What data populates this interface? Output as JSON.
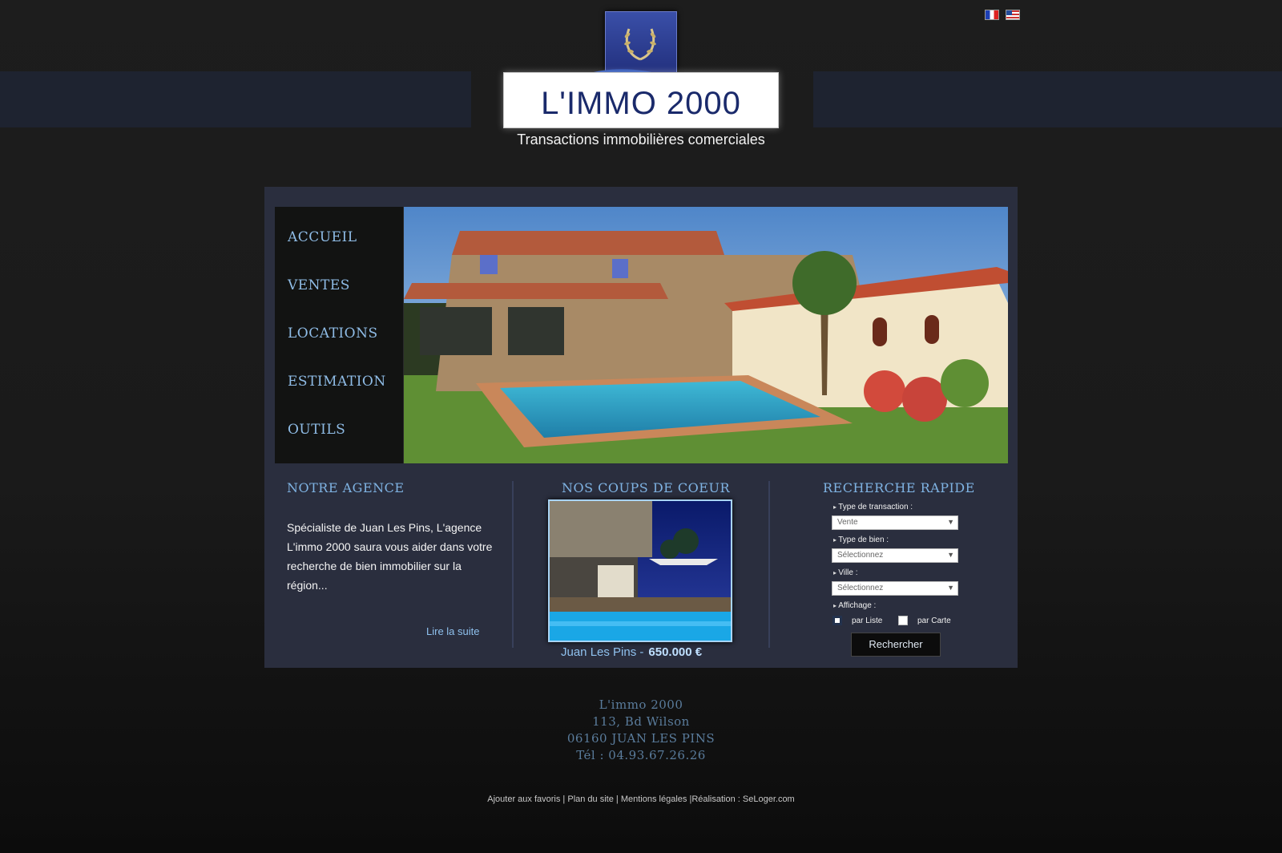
{
  "header": {
    "logo_text": "L'IMMO 2000",
    "tagline": "Transactions immobilières comerciales",
    "languages": [
      {
        "code": "fr",
        "icon": "french-flag-icon"
      },
      {
        "code": "en",
        "icon": "us-flag-icon"
      }
    ]
  },
  "nav": {
    "items": [
      "ACCUEIL",
      "VENTES",
      "LOCATIONS",
      "ESTIMATION",
      "OUTILS"
    ]
  },
  "agence": {
    "title": "NOTRE AGENCE",
    "text": "Spécialiste de Juan Les Pins, L'agence L'immo 2000 saura vous aider dans votre recherche de bien immobilier sur la région...",
    "read_more": "Lire la suite"
  },
  "coups_de_coeur": {
    "title": "NOS COUPS DE COEUR",
    "city": "Juan Les Pins -",
    "price": "650.000 €"
  },
  "recherche": {
    "title": "RECHERCHE RAPIDE",
    "transaction_label": "Type de transaction :",
    "transaction_value": "Vente",
    "bien_label": "Type de bien :",
    "bien_value": "Sélectionnez",
    "ville_label": "Ville :",
    "ville_value": "Sélectionnez",
    "affichage_label": "Affichage :",
    "par_liste": "par Liste",
    "par_carte": "par Carte",
    "submit": "Rechercher"
  },
  "address": {
    "name": "L'immo 2000",
    "street": "113, Bd Wilson",
    "city": "06160 JUAN LES PINS",
    "phone": "Tél : 04.93.67.26.26"
  },
  "footer": {
    "favoris": "Ajouter aux favoris",
    "sep1": " | ",
    "plan": "Plan du site",
    "sep2": " | ",
    "mentions": "Mentions légales",
    "sep3": " |",
    "realisation": "Réalisation : SeLoger.com"
  },
  "colors": {
    "background": "#1a1a1a",
    "panel": "#2a2e3e",
    "accent_blue": "#7fb3e3",
    "logo_blue": "#1a2a6b"
  }
}
